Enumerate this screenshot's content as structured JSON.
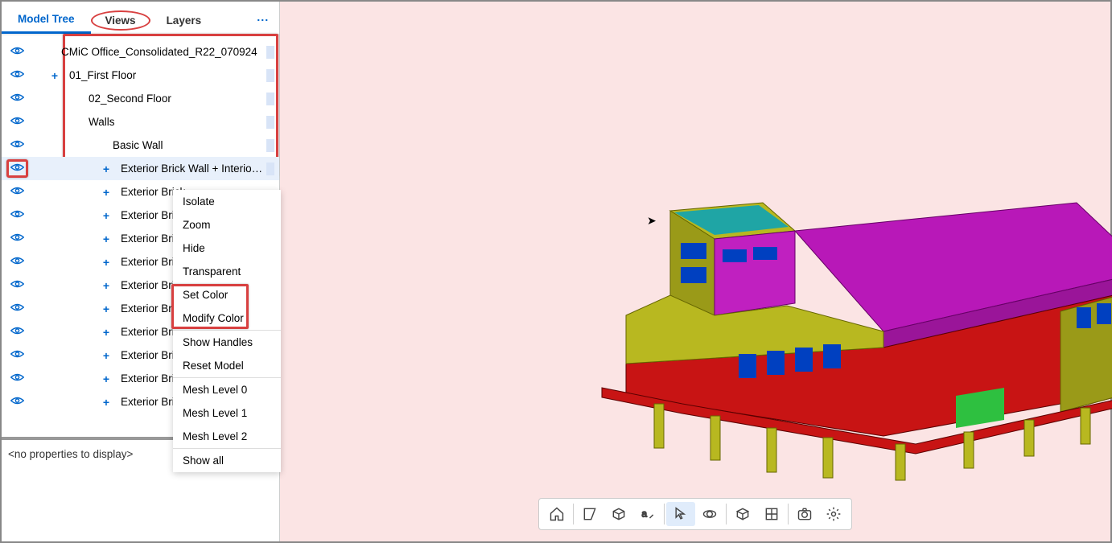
{
  "tabs": {
    "modelTree": "Model Tree",
    "views": "Views",
    "layers": "Layers"
  },
  "tree": {
    "root": "CMiC Office_Consolidated_R22_070924",
    "first": "01_First Floor",
    "second": "02_Second Floor",
    "walls": "Walls",
    "basicWall": "Basic Wall",
    "extBrickLong": "Exterior Brick Wall + Interior Drywall ...",
    "extShort": "Exterior Brick"
  },
  "contextMenu": {
    "isolate": "Isolate",
    "zoom": "Zoom",
    "hide": "Hide",
    "transparent": "Transparent",
    "setColor": "Set Color",
    "modifyColor": "Modify Color",
    "showHandles": "Show Handles",
    "resetModel": "Reset Model",
    "mesh0": "Mesh Level 0",
    "mesh1": "Mesh Level 1",
    "mesh2": "Mesh Level 2",
    "showAll": "Show all"
  },
  "props": {
    "empty": "<no properties to display>"
  },
  "toolbar": {
    "home": "home",
    "plane": "plane",
    "cube": "cube",
    "text": "text",
    "select": "select",
    "orbit": "orbit",
    "box": "box",
    "grid": "grid",
    "camera": "camera",
    "settings": "settings"
  }
}
